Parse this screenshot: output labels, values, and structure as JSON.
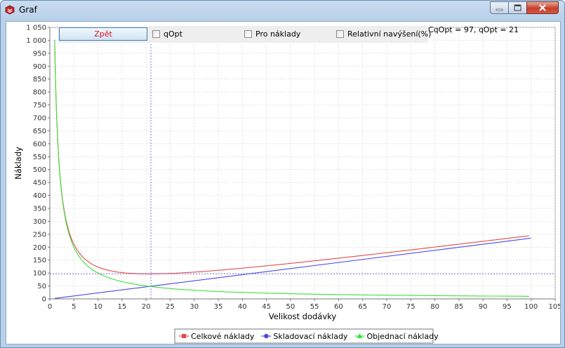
{
  "window": {
    "title": "Graf",
    "buttons": {
      "minimize": "minimize-icon",
      "maximize": "maximize-icon",
      "close": "close-icon"
    }
  },
  "toolbar": {
    "back_label": "Zpět",
    "checkboxes": [
      {
        "label": "qOpt",
        "checked": false
      },
      {
        "label": "Pro náklady",
        "checked": false
      },
      {
        "label": "Relativní navýšení(%)",
        "checked": false
      }
    ],
    "readout": "CqOpt = 97, qOpt = 21"
  },
  "colors": {
    "total": "#e04a4a",
    "storage": "#4a4ae0",
    "order": "#3ae03a",
    "guide": "#5a5ae0",
    "back_text": "#e1101c"
  },
  "chart_data": {
    "type": "line",
    "xlabel": "Velikost dodávky",
    "ylabel": "Náklady",
    "xlim": [
      0,
      105
    ],
    "ylim": [
      0,
      1050
    ],
    "x_ticks": [
      0,
      5,
      10,
      15,
      20,
      25,
      30,
      35,
      40,
      45,
      50,
      55,
      60,
      65,
      70,
      75,
      80,
      85,
      90,
      95,
      100,
      105
    ],
    "y_ticks": [
      0,
      50,
      100,
      150,
      200,
      250,
      300,
      350,
      400,
      450,
      500,
      550,
      600,
      650,
      700,
      750,
      800,
      850,
      900,
      950,
      1000,
      1050
    ],
    "y_tick_labels": [
      "0",
      "50",
      "100",
      "150",
      "200",
      "250",
      "300",
      "350",
      "400",
      "450",
      "500",
      "550",
      "600",
      "650",
      "700",
      "750",
      "800",
      "850",
      "900",
      "950",
      "1 000",
      "1 050"
    ],
    "grid": true,
    "legend_position": "bottom-center",
    "guides": {
      "qOpt": 21,
      "CqOpt": 97
    },
    "series": [
      {
        "name": "Celkové náklady",
        "color": "#e04a4a",
        "x": [
          1,
          2,
          3,
          4,
          5,
          6,
          8,
          10,
          12,
          15,
          18,
          21,
          25,
          30,
          35,
          40,
          50,
          60,
          70,
          80,
          90,
          100
        ],
        "y": [
          1000,
          502,
          337,
          256,
          210,
          179,
          143,
          121,
          107,
          98,
          96,
          97,
          99,
          104,
          112,
          121,
          142,
          163,
          186,
          207,
          230,
          242
        ]
      },
      {
        "name": "Skladovací náklady",
        "color": "#4a4ae0",
        "x": [
          1,
          100
        ],
        "y": [
          2,
          235
        ]
      },
      {
        "name": "Objednací náklady",
        "color": "#3ae03a",
        "x": [
          1,
          2,
          3,
          4,
          5,
          6,
          8,
          10,
          12,
          15,
          18,
          21,
          25,
          30,
          35,
          40,
          50,
          60,
          70,
          80,
          90,
          100
        ],
        "y": [
          1000,
          500,
          333,
          250,
          200,
          167,
          125,
          100,
          83,
          67,
          56,
          48,
          40,
          33,
          29,
          25,
          20,
          17,
          14,
          13,
          11,
          10
        ]
      }
    ]
  }
}
